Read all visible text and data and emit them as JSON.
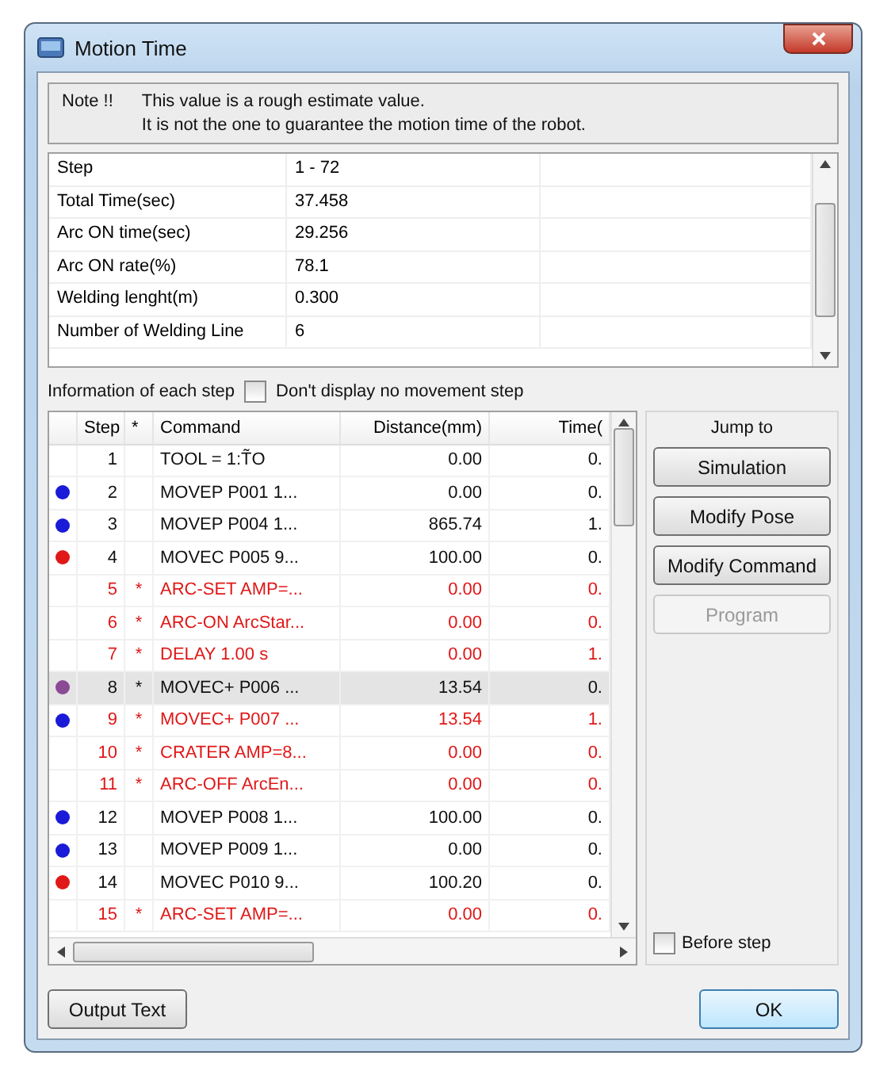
{
  "window": {
    "title": "Motion Time"
  },
  "note": {
    "label": "Note !!",
    "lines": [
      "This value is a rough estimate value.",
      "It is not the one to guarantee the motion time of the robot."
    ]
  },
  "summary": [
    {
      "name": "Step",
      "value": "1 - 72"
    },
    {
      "name": "Total Time(sec)",
      "value": "37.458"
    },
    {
      "name": "Arc ON time(sec)",
      "value": "29.256"
    },
    {
      "name": "Arc ON rate(%)",
      "value": "78.1"
    },
    {
      "name": "Welding lenght(m)",
      "value": "0.300"
    },
    {
      "name": "Number of Welding Line",
      "value": "6"
    }
  ],
  "steps_section": {
    "label": "Information of each step",
    "filter": {
      "label": "Don't display no movement step",
      "checked": false
    }
  },
  "table": {
    "columns": [
      "Step",
      "*",
      "Command",
      "Distance(mm)",
      "Time("
    ],
    "rows": [
      {
        "step": "1",
        "mark": "",
        "command": "TOOL = 1:T̃O",
        "distance": "0.00",
        "time": "0.",
        "arc": false,
        "selected": false
      },
      {
        "step": "2",
        "mark": "",
        "command": "MOVEP P001 1...",
        "distance": "0.00",
        "time": "0.",
        "arc": false,
        "selected": false,
        "color": "#1a1ad8"
      },
      {
        "step": "3",
        "mark": "",
        "command": "MOVEP P004 1...",
        "distance": "865.74",
        "time": "1.",
        "arc": false,
        "selected": false,
        "color": "#1a1ad8"
      },
      {
        "step": "4",
        "mark": "",
        "command": "MOVEC P005 9...",
        "distance": "100.00",
        "time": "0.",
        "arc": false,
        "selected": false,
        "color": "#e01818"
      },
      {
        "step": "5",
        "mark": "*",
        "command": "ARC-SET AMP=...",
        "distance": "0.00",
        "time": "0.",
        "arc": true,
        "selected": false
      },
      {
        "step": "6",
        "mark": "*",
        "command": "ARC-ON ArcStar...",
        "distance": "0.00",
        "time": "0.",
        "arc": true,
        "selected": false
      },
      {
        "step": "7",
        "mark": "*",
        "command": "DELAY 1.00 s",
        "distance": "0.00",
        "time": "1.",
        "arc": true,
        "selected": false
      },
      {
        "step": "8",
        "mark": "*",
        "command": "MOVEC+ P006 ...",
        "distance": "13.54",
        "time": "0.",
        "arc": false,
        "selected": true,
        "color": "#8a4a94"
      },
      {
        "step": "9",
        "mark": "*",
        "command": "MOVEC+ P007 ...",
        "distance": "13.54",
        "time": "1.",
        "arc": true,
        "selected": false,
        "color": "#1a1ad8"
      },
      {
        "step": "10",
        "mark": "*",
        "command": "CRATER AMP=8...",
        "distance": "0.00",
        "time": "0.",
        "arc": true,
        "selected": false
      },
      {
        "step": "11",
        "mark": "*",
        "command": "ARC-OFF ArcEn...",
        "distance": "0.00",
        "time": "0.",
        "arc": true,
        "selected": false
      },
      {
        "step": "12",
        "mark": "",
        "command": "MOVEP P008 1...",
        "distance": "100.00",
        "time": "0.",
        "arc": false,
        "selected": false,
        "color": "#1a1ad8"
      },
      {
        "step": "13",
        "mark": "",
        "command": "MOVEP P009 1...",
        "distance": "0.00",
        "time": "0.",
        "arc": false,
        "selected": false,
        "color": "#1a1ad8"
      },
      {
        "step": "14",
        "mark": "",
        "command": "MOVEC P010 9...",
        "distance": "100.20",
        "time": "0.",
        "arc": false,
        "selected": false,
        "color": "#e01818"
      },
      {
        "step": "15",
        "mark": "*",
        "command": "ARC-SET AMP=...",
        "distance": "0.00",
        "time": "0.",
        "arc": true,
        "selected": false
      }
    ]
  },
  "jump": {
    "title": "Jump to",
    "buttons": [
      {
        "label": "Simulation",
        "disabled": false
      },
      {
        "label": "Modify Pose",
        "disabled": false
      },
      {
        "label": "Modify Command",
        "disabled": false
      },
      {
        "label": "Program",
        "disabled": true
      }
    ],
    "before_step": {
      "label": "Before step",
      "checked": false
    }
  },
  "footer": {
    "left_button": "Output Text",
    "ok_button": "OK"
  }
}
